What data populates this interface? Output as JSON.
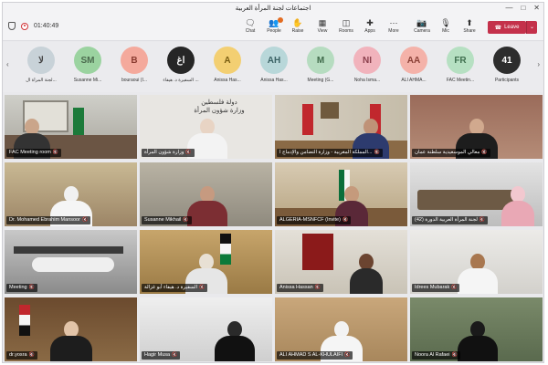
{
  "window": {
    "title": "اجتماعات لجنة المرأة العربية"
  },
  "call": {
    "timer": "01:40:49"
  },
  "toolbar": {
    "chat": "Chat",
    "people": "People",
    "raise": "Raise",
    "view": "View",
    "rooms": "Rooms",
    "apps": "Apps",
    "more": "More",
    "camera": "Camera",
    "mic": "Mic",
    "share": "Share",
    "leave": "Leave"
  },
  "participants_strip": [
    {
      "initials": "لا",
      "name": "لجنة المرأة ال...",
      "color": "#c8d2d8",
      "text_color": "#444444"
    },
    {
      "initials": "SM",
      "name": "Susanne Mi...",
      "color": "#9bd3a0",
      "text_color": "#4b6b4e"
    },
    {
      "initials": "B",
      "name": "bouraoui (I...",
      "color": "#f4a99c",
      "text_color": "#8a3b30"
    },
    {
      "initials": "اغ",
      "name": "السفيرة د. هيفاء ...",
      "color": "#262626",
      "text_color": "#ffffff"
    },
    {
      "initials": "A",
      "name": "Anissa Has...",
      "color": "#f3cf72",
      "text_color": "#7a5e12"
    },
    {
      "initials": "AH",
      "name": "Anissa Has...",
      "color": "#b8d7d9",
      "text_color": "#3b6265"
    },
    {
      "initials": "M",
      "name": "Meeting (G...",
      "color": "#b6dcc0",
      "text_color": "#3f6a4a"
    },
    {
      "initials": "NI",
      "name": "Noha Isma...",
      "color": "#f1b3bc",
      "text_color": "#8a3e4b"
    },
    {
      "initials": "AA",
      "name": "ALI AHMA...",
      "color": "#f4b2a9",
      "text_color": "#8a4036"
    },
    {
      "initials": "FR",
      "name": "FAC Meetin...",
      "color": "#b6e0c2",
      "text_color": "#3f6f4e"
    },
    {
      "initials": "41",
      "name": "Participants",
      "color": "#2d2d2d",
      "text_color": "#ffffff"
    }
  ],
  "tiles": [
    {
      "name": "FAC Meeting room"
    },
    {
      "name": "وزارة شؤون المرأة",
      "sign": "دولة فلسطين\nوزارة شؤون المرأة"
    },
    {
      "name": "المملكة المغربية - وزارة التضامن والإدماج ا..."
    },
    {
      "name": "معالي الموسعيدية سلطنة عمان"
    },
    {
      "name": "Dr. Mohamed Ebrahim Mansoor"
    },
    {
      "name": "Susanne Mikhail"
    },
    {
      "name": "ALGERIA-MSNFCF (Invite)"
    },
    {
      "name": "لجنة المرأة العربية الدورة (42)"
    },
    {
      "name": "Meeting"
    },
    {
      "name": "السفيرة د. هيفاء أبو غزالة"
    },
    {
      "name": "Anissa Hassan"
    },
    {
      "name": "Idrees Mubarak"
    },
    {
      "name": "dr.yosra"
    },
    {
      "name": "Hagir Musa"
    },
    {
      "name": "ALI AHMAD S AL-KHULAIFI"
    },
    {
      "name": "Noora Al Rafaei"
    }
  ]
}
